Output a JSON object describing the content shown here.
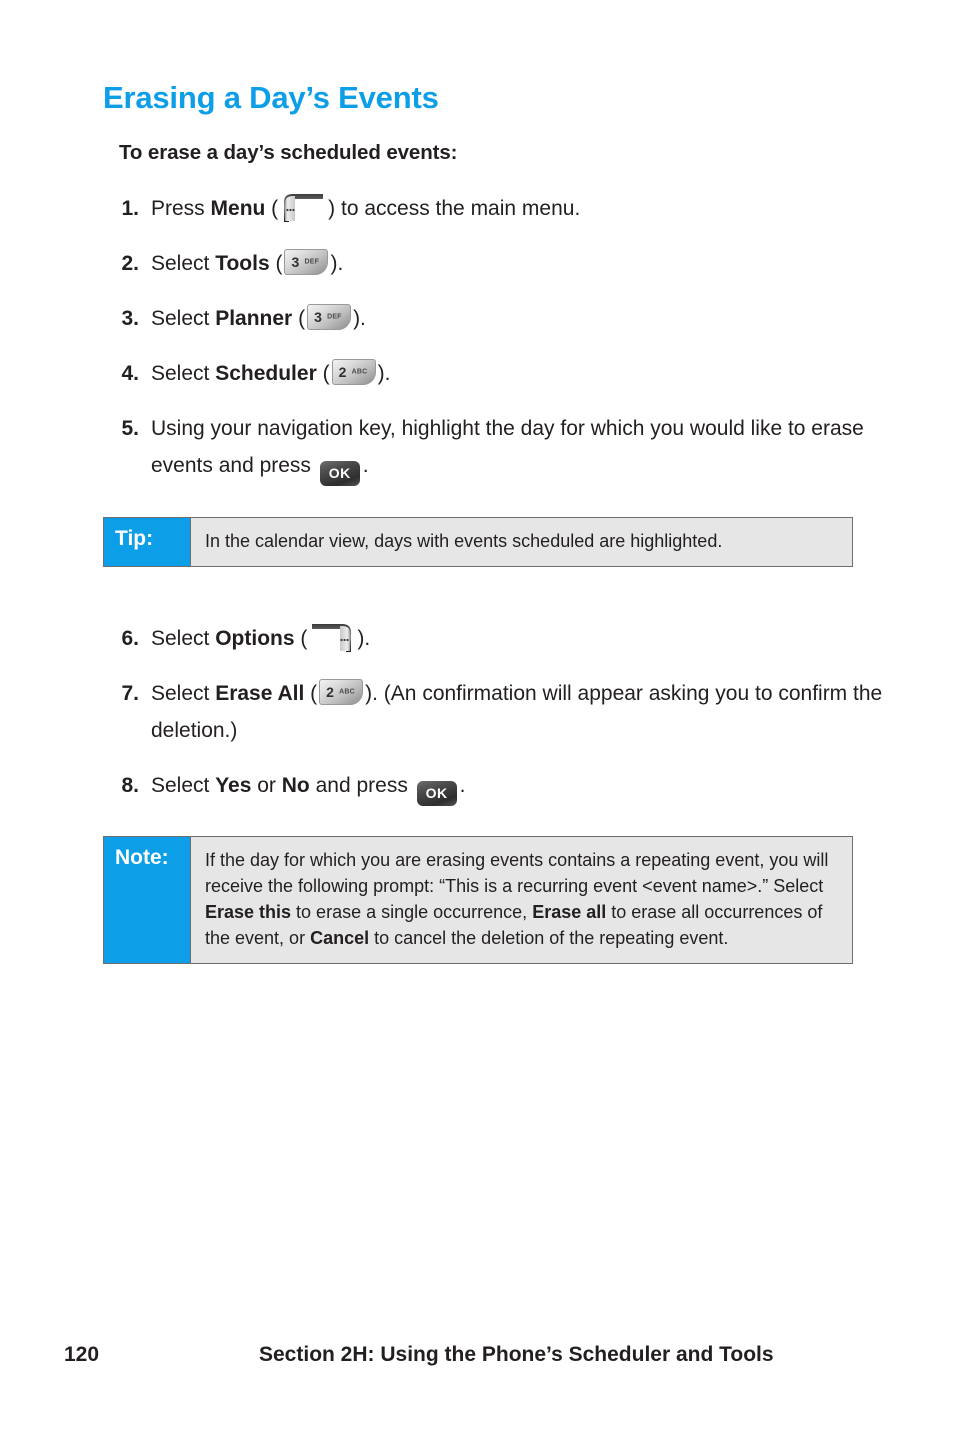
{
  "colors": {
    "accent_blue": "#0d9ee8",
    "body_text": "#231f20",
    "callout_bg": "#e6e6e6",
    "callout_border": "#6d6e71",
    "key_dark": "#2e2e2e"
  },
  "heading": "Erasing a Day’s Events",
  "subheading": "To erase a day’s scheduled events:",
  "steps_upper": [
    {
      "number": "1.",
      "pre": "Press ",
      "bold": "Menu",
      "mid": " (",
      "icon": "softkey-left-menu-icon",
      "post": ") to access the main menu."
    },
    {
      "number": "2.",
      "pre": "Select ",
      "bold": "Tools",
      "mid": " (",
      "icon": "key-3-def-icon",
      "key_digit": "3",
      "key_letters": "DEF",
      "post": ")."
    },
    {
      "number": "3.",
      "pre": "Select ",
      "bold": "Planner",
      "mid": " (",
      "icon": "key-3-def-icon",
      "key_digit": "3",
      "key_letters": "DEF",
      "post": ")."
    },
    {
      "number": "4.",
      "pre": "Select ",
      "bold": "Scheduler",
      "mid": " (",
      "icon": "key-2-abc-icon",
      "key_digit": "2",
      "key_letters": "ABC",
      "post": ")."
    },
    {
      "number": "5.",
      "pre": "Using your navigation key, highlight the day for which you would like to erase events and press ",
      "bold": "",
      "mid": "",
      "icon": "key-ok-icon",
      "key_label": "OK",
      "post": "."
    }
  ],
  "steps_lower": [
    {
      "number": "6.",
      "pre": "Select ",
      "bold": "Options",
      "mid": " (",
      "icon": "softkey-right-options-icon",
      "post": ")."
    },
    {
      "number": "7.",
      "pre": "Select ",
      "bold": "Erase All",
      "mid": " (",
      "icon": "key-2-abc-icon",
      "key_digit": "2",
      "key_letters": "ABC",
      "post": "). (An confirmation will appear asking you to confirm the deletion.)"
    },
    {
      "number": "8.",
      "pre": "Select ",
      "bold": "Yes",
      "mid": " or ",
      "bold2": "No",
      "mid2": " and press ",
      "icon": "key-ok-icon",
      "key_label": "OK",
      "post": "."
    }
  ],
  "tip": {
    "label": "Tip:",
    "body": "In the calendar view, days with events scheduled are highlighted."
  },
  "note": {
    "label": "Note:",
    "body_part1": "If the day for which you are erasing events contains a repeating event, you will receive the following prompt: “This is a recurring event <event name>.” Select ",
    "bold1": "Erase this",
    "body_part2": " to erase a single occurrence, ",
    "bold2": "Erase all",
    "body_part3": " to erase all occurrences of the event, or ",
    "bold3": "Cancel",
    "body_part4": " to cancel the deletion of the repeating event."
  },
  "footer": {
    "page_number": "120",
    "section": "Section 2H: Using the Phone’s Scheduler and Tools"
  }
}
